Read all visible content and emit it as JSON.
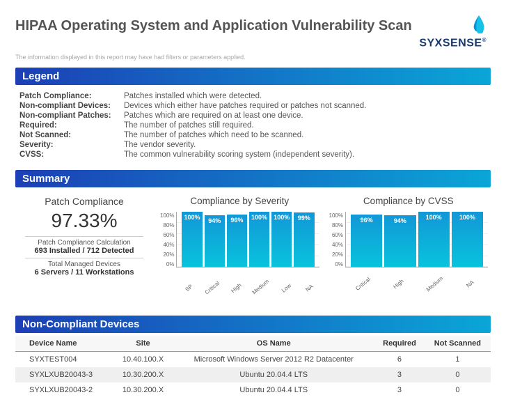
{
  "header": {
    "title": "HIPAA Operating System and Application Vulnerability Scan",
    "brand": "SYXSENSE",
    "disclaimer": "The information displayed in this report may have had filters or parameters applied."
  },
  "sections": {
    "legend": "Legend",
    "summary": "Summary",
    "noncompliant": "Non-Compliant Devices"
  },
  "legend": [
    {
      "term": "Patch Compliance:",
      "def": "Patches installed which were detected."
    },
    {
      "term": "Non-compliant Devices:",
      "def": "Devices which either have patches required or patches not scanned."
    },
    {
      "term": "Non-compliant Patches:",
      "def": "Patches which are required on at least one device."
    },
    {
      "term": "Required:",
      "def": "The number of patches still required."
    },
    {
      "term": "Not Scanned:",
      "def": "The number of patches which need to be scanned."
    },
    {
      "term": "Severity:",
      "def": "The vendor severity."
    },
    {
      "term": "CVSS:",
      "def": "The common vulnerability scoring system (independent severity)."
    }
  ],
  "summary": {
    "patch_title": "Patch Compliance",
    "patch_value": "97.33%",
    "calc_label": "Patch Compliance Calculation",
    "calc_value": "693 Installed / 712 Detected",
    "devices_label": "Total Managed Devices",
    "devices_value": "6 Servers / 11 Workstations",
    "sev_title": "Compliance by Severity",
    "cvss_title": "Compliance by CVSS"
  },
  "chart_data": [
    {
      "type": "bar",
      "title": "Compliance by Severity",
      "ylabel": "",
      "xlabel": "",
      "ylim": [
        0,
        100
      ],
      "yticks": [
        "100%",
        "80%",
        "60%",
        "40%",
        "20%",
        "0%"
      ],
      "categories": [
        "SP",
        "Critical",
        "High",
        "Medium",
        "Low",
        "NA"
      ],
      "values": [
        100,
        94,
        96,
        100,
        100,
        99
      ]
    },
    {
      "type": "bar",
      "title": "Compliance by CVSS",
      "ylabel": "",
      "xlabel": "",
      "ylim": [
        0,
        100
      ],
      "yticks": [
        "100%",
        "80%",
        "60%",
        "40%",
        "20%",
        "0%"
      ],
      "categories": [
        "Critical",
        "High",
        "Medium",
        "NA"
      ],
      "values": [
        96,
        94,
        100,
        100
      ]
    }
  ],
  "table": {
    "headers": [
      "Device Name",
      "Site",
      "OS Name",
      "Required",
      "Not Scanned"
    ],
    "rows": [
      [
        "SYXTEST004",
        "10.40.100.X",
        "Microsoft Windows Server 2012 R2 Datacenter",
        "6",
        "1"
      ],
      [
        "SYXLXUB20043-3",
        "10.30.200.X",
        "Ubuntu 20.04.4 LTS",
        "3",
        "0"
      ],
      [
        "SYXLXUB20043-2",
        "10.30.200.X",
        "Ubuntu 20.04.4 LTS",
        "3",
        "0"
      ]
    ]
  }
}
